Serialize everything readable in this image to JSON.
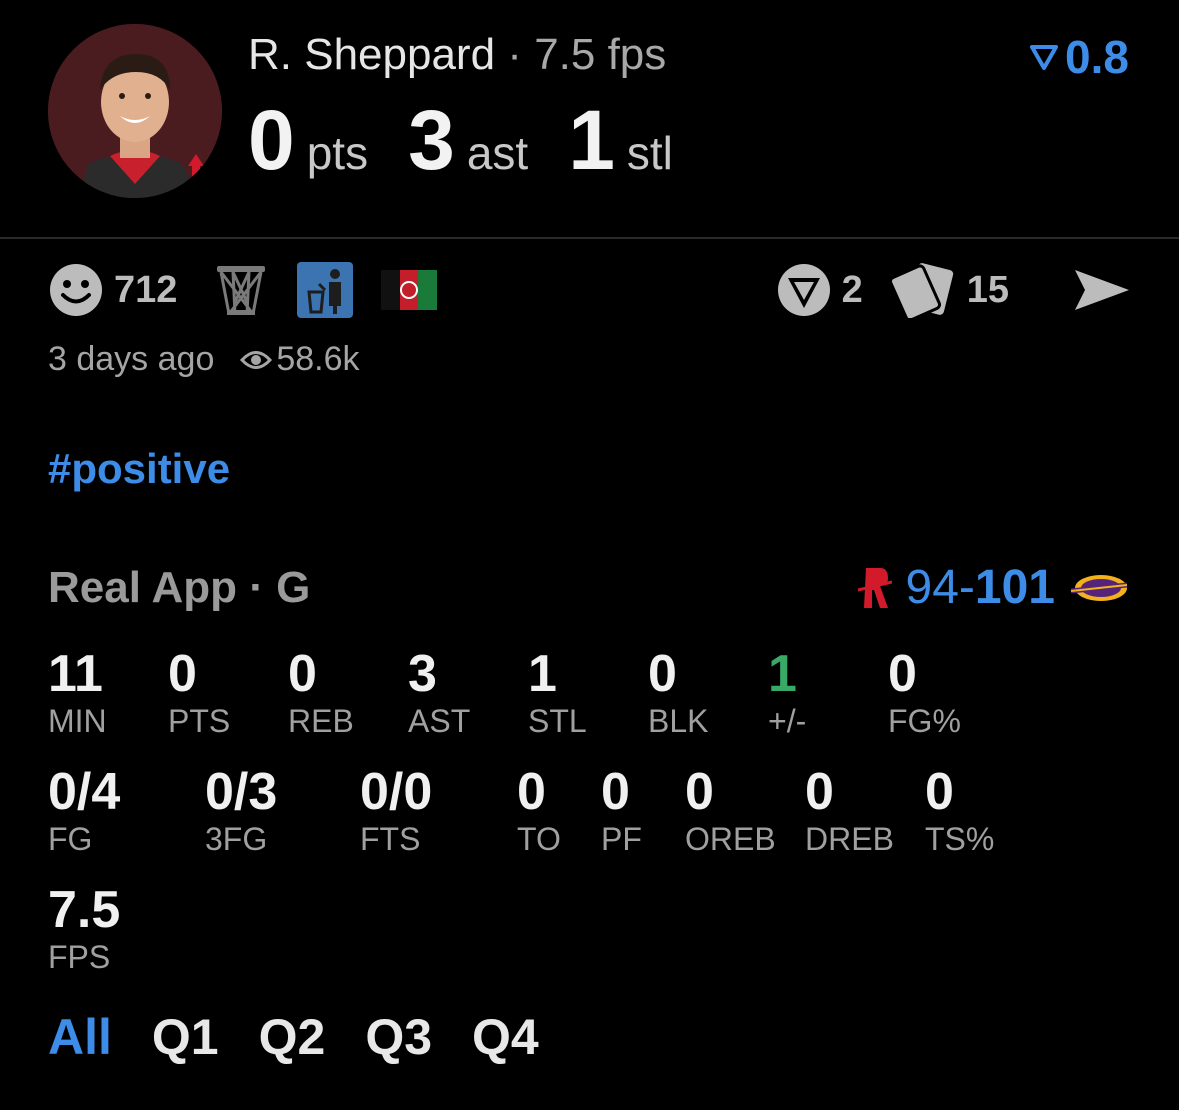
{
  "header": {
    "player_name": "R. Sheppard",
    "separator": "·",
    "fps_text": "7.5 fps",
    "rating": "0.8",
    "big_stats": [
      {
        "value": "0",
        "label": "pts"
      },
      {
        "value": "3",
        "label": "ast"
      },
      {
        "value": "1",
        "label": "stl"
      }
    ]
  },
  "reactions": {
    "smiley_count": "712",
    "comment_count": "2",
    "cards_count": "15"
  },
  "meta": {
    "time_ago": "3 days ago",
    "views": "58.6k"
  },
  "hashtag": "#positive",
  "game": {
    "label": "Real App · G",
    "score_home": "94",
    "score_dash": "-",
    "score_away": "101"
  },
  "stats_row1": [
    {
      "value": "11",
      "label": "MIN"
    },
    {
      "value": "0",
      "label": "PTS"
    },
    {
      "value": "0",
      "label": "REB"
    },
    {
      "value": "3",
      "label": "AST"
    },
    {
      "value": "1",
      "label": "STL"
    },
    {
      "value": "0",
      "label": "BLK"
    },
    {
      "value": "1",
      "label": "+/-"
    },
    {
      "value": "0",
      "label": "FG%"
    }
  ],
  "stats_row2": [
    {
      "value": "0/4",
      "label": "FG"
    },
    {
      "value": "0/3",
      "label": "3FG"
    },
    {
      "value": "0/0",
      "label": "FTS"
    },
    {
      "value": "0",
      "label": "TO"
    },
    {
      "value": "0",
      "label": "PF"
    },
    {
      "value": "0",
      "label": "OREB"
    },
    {
      "value": "0",
      "label": "DREB"
    },
    {
      "value": "0",
      "label": "TS%"
    }
  ],
  "stats_row3": [
    {
      "value": "7.5",
      "label": "FPS"
    }
  ],
  "tabs": [
    "All",
    "Q1",
    "Q2",
    "Q3",
    "Q4"
  ],
  "colors": {
    "accent": "#3d8de8",
    "positive": "#39a968",
    "background": "#000000"
  }
}
